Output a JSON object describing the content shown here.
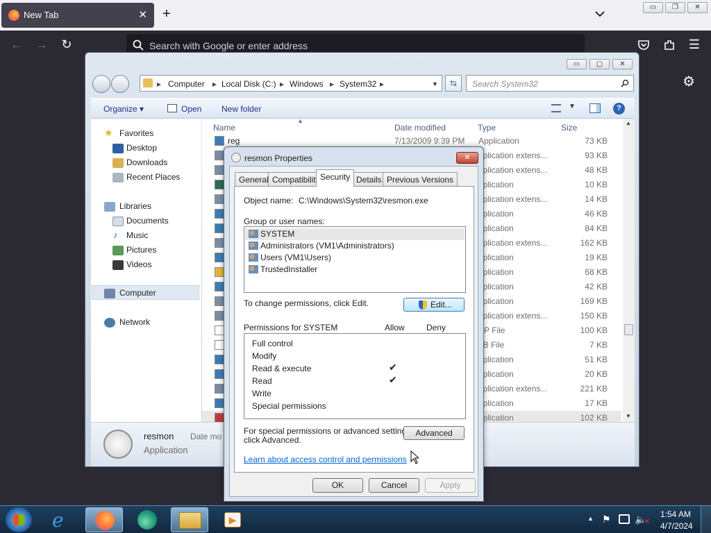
{
  "browser": {
    "tab_title": "New Tab",
    "tab_close": "✕",
    "new_tab": "+",
    "list_all_tabs": "⌄",
    "win_minimize": "▭",
    "win_restore": "❐",
    "win_close": "✕",
    "url_placeholder": "Search with Google or enter address",
    "nav_back": "←",
    "nav_forward": "→",
    "nav_reload": "↻",
    "menu": "☰",
    "settings": "⚙"
  },
  "explorer": {
    "win_minimize": "▭",
    "win_maximize": "▢",
    "win_close": "✕",
    "breadcrumbs": [
      "Computer",
      "Local Disk (C:)",
      "Windows",
      "System32"
    ],
    "search_placeholder": "Search System32",
    "toolbar": {
      "organize": "Organize",
      "open": "Open",
      "new_folder": "New folder"
    },
    "nav": {
      "favorites": "Favorites",
      "favorites_items": [
        "Desktop",
        "Downloads",
        "Recent Places"
      ],
      "libraries": "Libraries",
      "libraries_items": [
        "Documents",
        "Music",
        "Pictures",
        "Videos"
      ],
      "computer": "Computer",
      "network": "Network"
    },
    "columns": {
      "name": "Name",
      "date": "Date modified",
      "type": "Type",
      "size": "Size"
    },
    "first_row": {
      "name": "reg",
      "date": "7/13/2009 9:39 PM"
    },
    "rows": [
      {
        "type": "Application",
        "size": "73 KB"
      },
      {
        "type": "pplication extens...",
        "size": "93 KB"
      },
      {
        "type": "pplication extens...",
        "size": "48 KB"
      },
      {
        "type": "pplication",
        "size": "10 KB"
      },
      {
        "type": "pplication extens...",
        "size": "14 KB"
      },
      {
        "type": "pplication",
        "size": "46 KB"
      },
      {
        "type": "pplication",
        "size": "84 KB"
      },
      {
        "type": "pplication extens...",
        "size": "162 KB"
      },
      {
        "type": "pplication",
        "size": "19 KB"
      },
      {
        "type": "pplication",
        "size": "68 KB"
      },
      {
        "type": "pplication",
        "size": "42 KB"
      },
      {
        "type": "pplication",
        "size": "169 KB"
      },
      {
        "type": "pplication extens...",
        "size": "150 KB"
      },
      {
        "type": "SP File",
        "size": "100 KB"
      },
      {
        "type": "LB File",
        "size": "7 KB"
      },
      {
        "type": "pplication",
        "size": "51 KB"
      },
      {
        "type": "pplication",
        "size": "20 KB"
      },
      {
        "type": "pplication extens...",
        "size": "221 KB"
      },
      {
        "type": "pplication",
        "size": "17 KB"
      },
      {
        "type": "pplication",
        "size": "102 KB"
      }
    ],
    "details": {
      "name": "resmon",
      "type": "Application",
      "date_label": "Date mo"
    }
  },
  "dialog": {
    "title": "resmon Properties",
    "close": "✕",
    "tabs": [
      "General",
      "Compatibility",
      "Security",
      "Details",
      "Previous Versions"
    ],
    "object_label": "Object name:",
    "object_value": "C:\\Windows\\System32\\resmon.exe",
    "group_label": "Group or user names:",
    "users": [
      "SYSTEM",
      "Administrators (VM1\\Administrators)",
      "Users (VM1\\Users)",
      "TrustedInstaller"
    ],
    "change_text": "To change permissions, click Edit.",
    "edit_button": "Edit...",
    "perm_label": "Permissions for SYSTEM",
    "allow": "Allow",
    "deny": "Deny",
    "permissions": [
      "Full control",
      "Modify",
      "Read & execute",
      "Read",
      "Write",
      "Special permissions"
    ],
    "checkmark": "✔",
    "special_text_1": "For special permissions or advanced settings,",
    "special_text_2": "click Advanced.",
    "advanced_button": "Advanced",
    "learn_link": "Learn about access control and permissions",
    "ok": "OK",
    "cancel": "Cancel",
    "apply": "Apply"
  },
  "taskbar": {
    "time": "1:54 AM",
    "date": "4/7/2024",
    "tray_arrow": "▲"
  }
}
